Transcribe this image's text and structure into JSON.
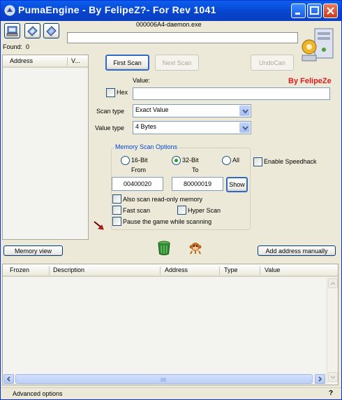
{
  "window": {
    "title": "PumaEngine - By FelipeZ?- For Rev 1041"
  },
  "process": {
    "name": "000006A4-daemon.exe",
    "progress_text": ""
  },
  "found": {
    "label": "Found:",
    "count": "0"
  },
  "results_list": {
    "columns": [
      "Address",
      "V..."
    ]
  },
  "buttons": {
    "first_scan": "First Scan",
    "next_scan": "Next Scan",
    "undo_scan": "UndoCan",
    "memory_view": "Memory view",
    "add_address": "Add address manually",
    "show": "Show"
  },
  "branding": {
    "text": "By FelipeZe",
    "color": "#D81C1C"
  },
  "value": {
    "label": "Value:",
    "hex_label": "Hex",
    "hex_checked": false,
    "input": ""
  },
  "scan_type": {
    "label": "Scan type",
    "selected": "Exact Value"
  },
  "value_type": {
    "label": "Value type",
    "selected": "4 Bytes"
  },
  "memory_scan": {
    "group_label": "Memory Scan Options",
    "radio_16": "16-Bit",
    "radio_32": "32-Bit",
    "radio_all": "All",
    "selected": "32-Bit",
    "from_label": "From",
    "to_label": "To",
    "from_value": "00400020",
    "to_value": "80000019",
    "readonly_label": "Also scan read-only memory",
    "fast_scan_label": "Fast scan",
    "hyper_scan_label": "Hyper Scan",
    "pause_label": "Pause the game while scanning"
  },
  "speedhack": {
    "label": "Enable Speedhack",
    "checked": false
  },
  "address_table": {
    "columns": [
      "Frozen",
      "Description",
      "Address",
      "Type",
      "Value"
    ],
    "rows": []
  },
  "statusbar": {
    "advanced": "Advanced options",
    "help": "?"
  },
  "icons": [
    "process-select-icon",
    "open-file-icon",
    "save-file-icon",
    "settings-computer-icon",
    "trash-can-icon",
    "monkey-icon",
    "red-arrow-icon"
  ]
}
